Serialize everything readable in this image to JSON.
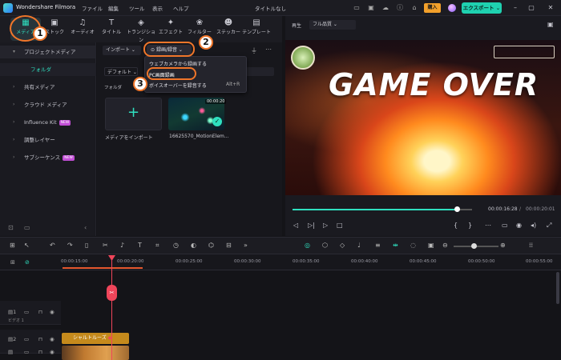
{
  "titlebar": {
    "app_name": "Wondershare Filmora",
    "menus": [
      "ファイル",
      "編集",
      "ツール",
      "表示",
      "ヘルプ"
    ],
    "project_title": "タイトルなし",
    "buy_label": "購入",
    "export_label": "エクスポート"
  },
  "media_tabs": [
    "メディア",
    "ストック",
    "オーディオ",
    "タイトル",
    "トランジション",
    "エフェクト",
    "フィルター",
    "ステッカー",
    "テンプレート"
  ],
  "sidebar": {
    "items": [
      {
        "label": "プロジェクトメディア",
        "badge": ""
      },
      {
        "label": "フォルダ",
        "badge": ""
      },
      {
        "label": "共有メディア",
        "badge": ""
      },
      {
        "label": "クラウド メディア",
        "badge": ""
      },
      {
        "label": "Influence Kit",
        "badge": "NEW"
      },
      {
        "label": "調整レイヤー",
        "badge": ""
      },
      {
        "label": "サブシーケンス",
        "badge": "NEW"
      }
    ]
  },
  "media": {
    "import_label": "インポート",
    "record_label": "録画/録音",
    "default_label": "デフォルト",
    "folder_label": "フォルダ",
    "import_card_label": "メディアをインポート",
    "clip_label": "16625570_MotionElem...",
    "clip_duration": "00:00:20"
  },
  "record_menu": {
    "items": [
      {
        "label": "ウェブカメラから録画する",
        "shortcut": ""
      },
      {
        "label": "PC画面録画",
        "shortcut": ""
      },
      {
        "label": "ボイスオーバーを録音する",
        "shortcut": "Alt+R"
      }
    ]
  },
  "annotations": [
    "1",
    "2",
    "3"
  ],
  "preview": {
    "player_label": "再生",
    "quality_label": "フル品質",
    "headline": "GAME OVER",
    "current_time": "00:00:16:28",
    "total_time": "00:00:20:01",
    "progress": 0.92
  },
  "timeline": {
    "ticks": [
      "00:00:15:00",
      "00:00:20:00",
      "00:00:25:00",
      "00:00:30:00",
      "00:00:35:00",
      "00:00:40:00",
      "00:00:45:00",
      "00:00:50:00",
      "00:00:55:00"
    ],
    "track1_label": "ビデオ 1",
    "clip_label": "シャルトルーズ"
  },
  "colors": {
    "accent": "#2fe0c0",
    "annotation": "#f0762a",
    "buy": "#f2a02b",
    "playhead": "#f0455a"
  }
}
